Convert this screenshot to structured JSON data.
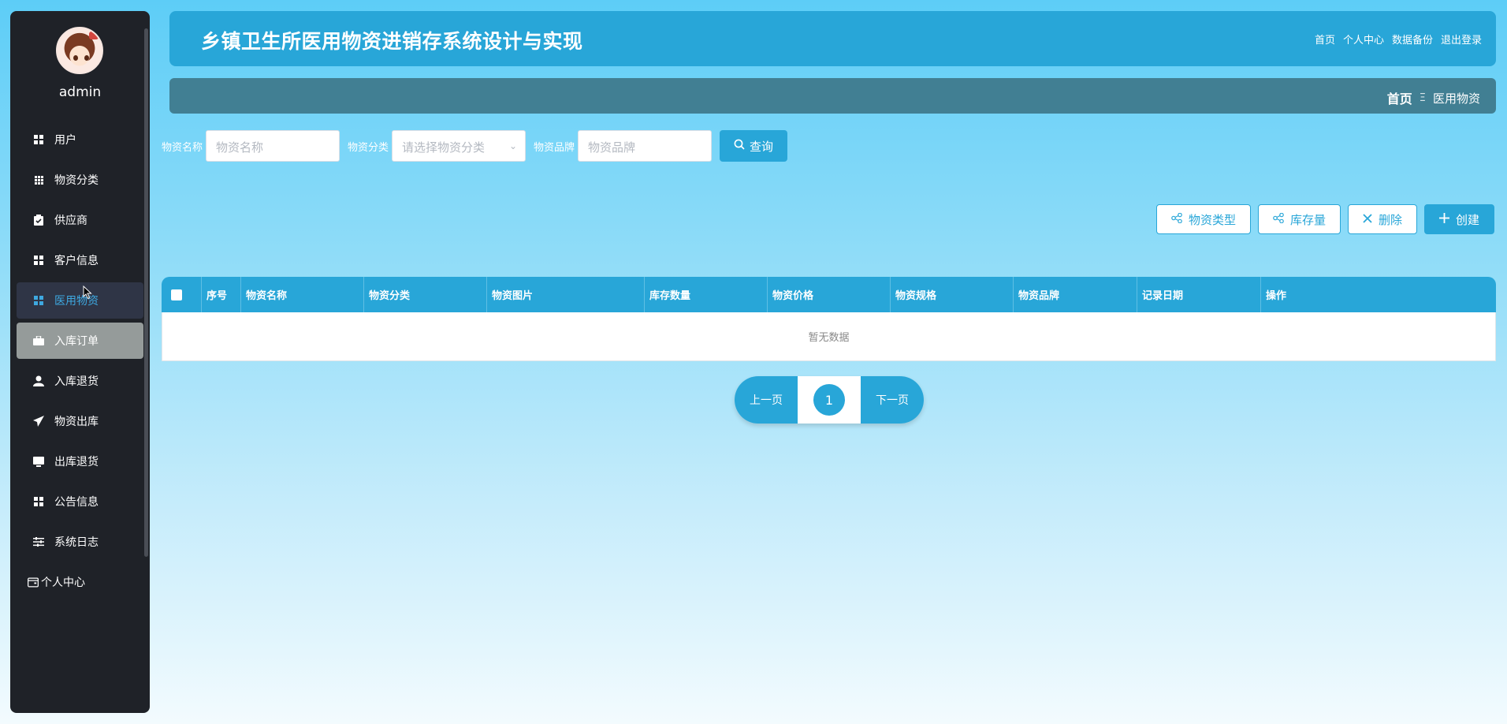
{
  "sidebar": {
    "username": "admin",
    "items": [
      {
        "label": "用户",
        "icon": "grid-icon"
      },
      {
        "label": "物资分类",
        "icon": "table-grid-icon"
      },
      {
        "label": "供应商",
        "icon": "clipboard-icon"
      },
      {
        "label": "客户信息",
        "icon": "grid-icon"
      },
      {
        "label": "医用物资",
        "icon": "grid-icon"
      },
      {
        "label": "入库订单",
        "icon": "briefcase-icon"
      },
      {
        "label": "入库退货",
        "icon": "user-icon"
      },
      {
        "label": "物资出库",
        "icon": "paper-plane-icon"
      },
      {
        "label": "出库退货",
        "icon": "monitor-icon"
      },
      {
        "label": "公告信息",
        "icon": "grid-icon"
      },
      {
        "label": "系统日志",
        "icon": "sliders-icon"
      }
    ],
    "personal": "个人中心"
  },
  "header": {
    "title": "乡镇卫生所医用物资进销存系统设计与实现",
    "links": [
      "首页",
      "个人中心",
      "数据备份",
      "退出登录"
    ]
  },
  "breadcrumb": {
    "home": "首页",
    "separator": "Ξ",
    "current": "医用物资"
  },
  "search": {
    "name_label": "物资名称",
    "name_placeholder": "物资名称",
    "category_label": "物资分类",
    "category_placeholder": "请选择物资分类",
    "brand_label": "物资品牌",
    "brand_placeholder": "物资品牌",
    "query_label": "查询"
  },
  "actions": {
    "type_label": "物资类型",
    "stock_label": "库存量",
    "delete_label": "删除",
    "create_label": "创建"
  },
  "table": {
    "columns": [
      "序号",
      "物资名称",
      "物资分类",
      "物资图片",
      "库存数量",
      "物资价格",
      "物资规格",
      "物资品牌",
      "记录日期",
      "操作"
    ],
    "empty_text": "暂无数据"
  },
  "pager": {
    "prev": "上一页",
    "current": "1",
    "next": "下一页"
  },
  "colors": {
    "primary": "#28a6d8",
    "sidebar_bg": "#1f2228",
    "breadcrumb_bg": "#417f93"
  }
}
